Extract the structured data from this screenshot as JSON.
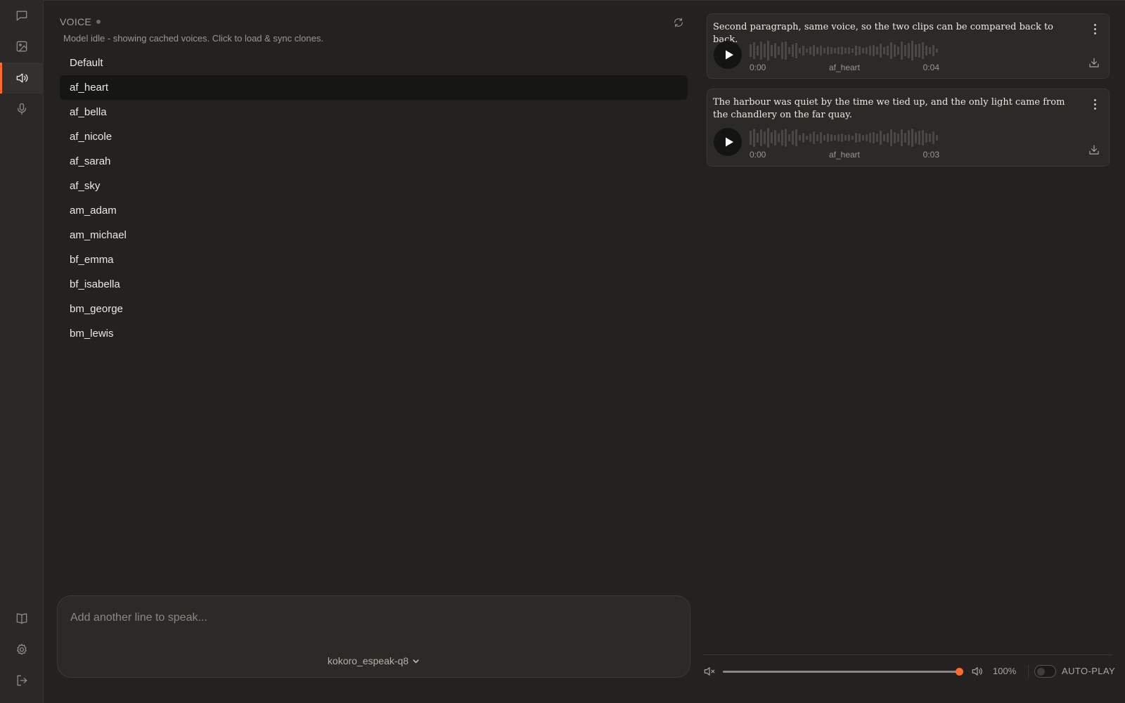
{
  "nav": {
    "items": [
      {
        "icon": "chat-icon",
        "active": false
      },
      {
        "icon": "image-icon",
        "active": false
      },
      {
        "icon": "speaker-icon",
        "active": true
      },
      {
        "icon": "microphone-icon",
        "active": false
      }
    ],
    "bottom": [
      {
        "icon": "book-icon"
      },
      {
        "icon": "gear-icon"
      },
      {
        "icon": "logout-icon"
      }
    ]
  },
  "voice_panel": {
    "title": "VOICE",
    "status": "Model idle - showing cached voices. Click to load & sync clones.",
    "selected": "af_heart",
    "voices": [
      "Default",
      "af_heart",
      "af_bella",
      "af_nicole",
      "af_sarah",
      "af_sky",
      "am_adam",
      "am_michael",
      "bf_emma",
      "bf_isabella",
      "bm_george",
      "bm_lewis"
    ]
  },
  "composer": {
    "placeholder": "Add another line to speak...",
    "model": "kokoro_espeak-q8"
  },
  "clips": [
    {
      "text": "Second paragraph, same voice, so the two clips can be compared back to back.",
      "time_current": "0:00",
      "voice": "af_heart",
      "duration": "0:04"
    },
    {
      "text": "The harbour was quiet by the time we tied up, and the only light came from the chandlery on the far quay.",
      "time_current": "0:00",
      "voice": "af_heart",
      "duration": "0:03"
    }
  ],
  "player": {
    "volume_label": "100%",
    "volume": 1.0,
    "autoplay_label": "AUTO-PLAY",
    "autoplay": false
  },
  "colors": {
    "accent": "#ff6b2c",
    "background": "#232220",
    "rail": "#2a2927",
    "card": "#2b2a27"
  }
}
